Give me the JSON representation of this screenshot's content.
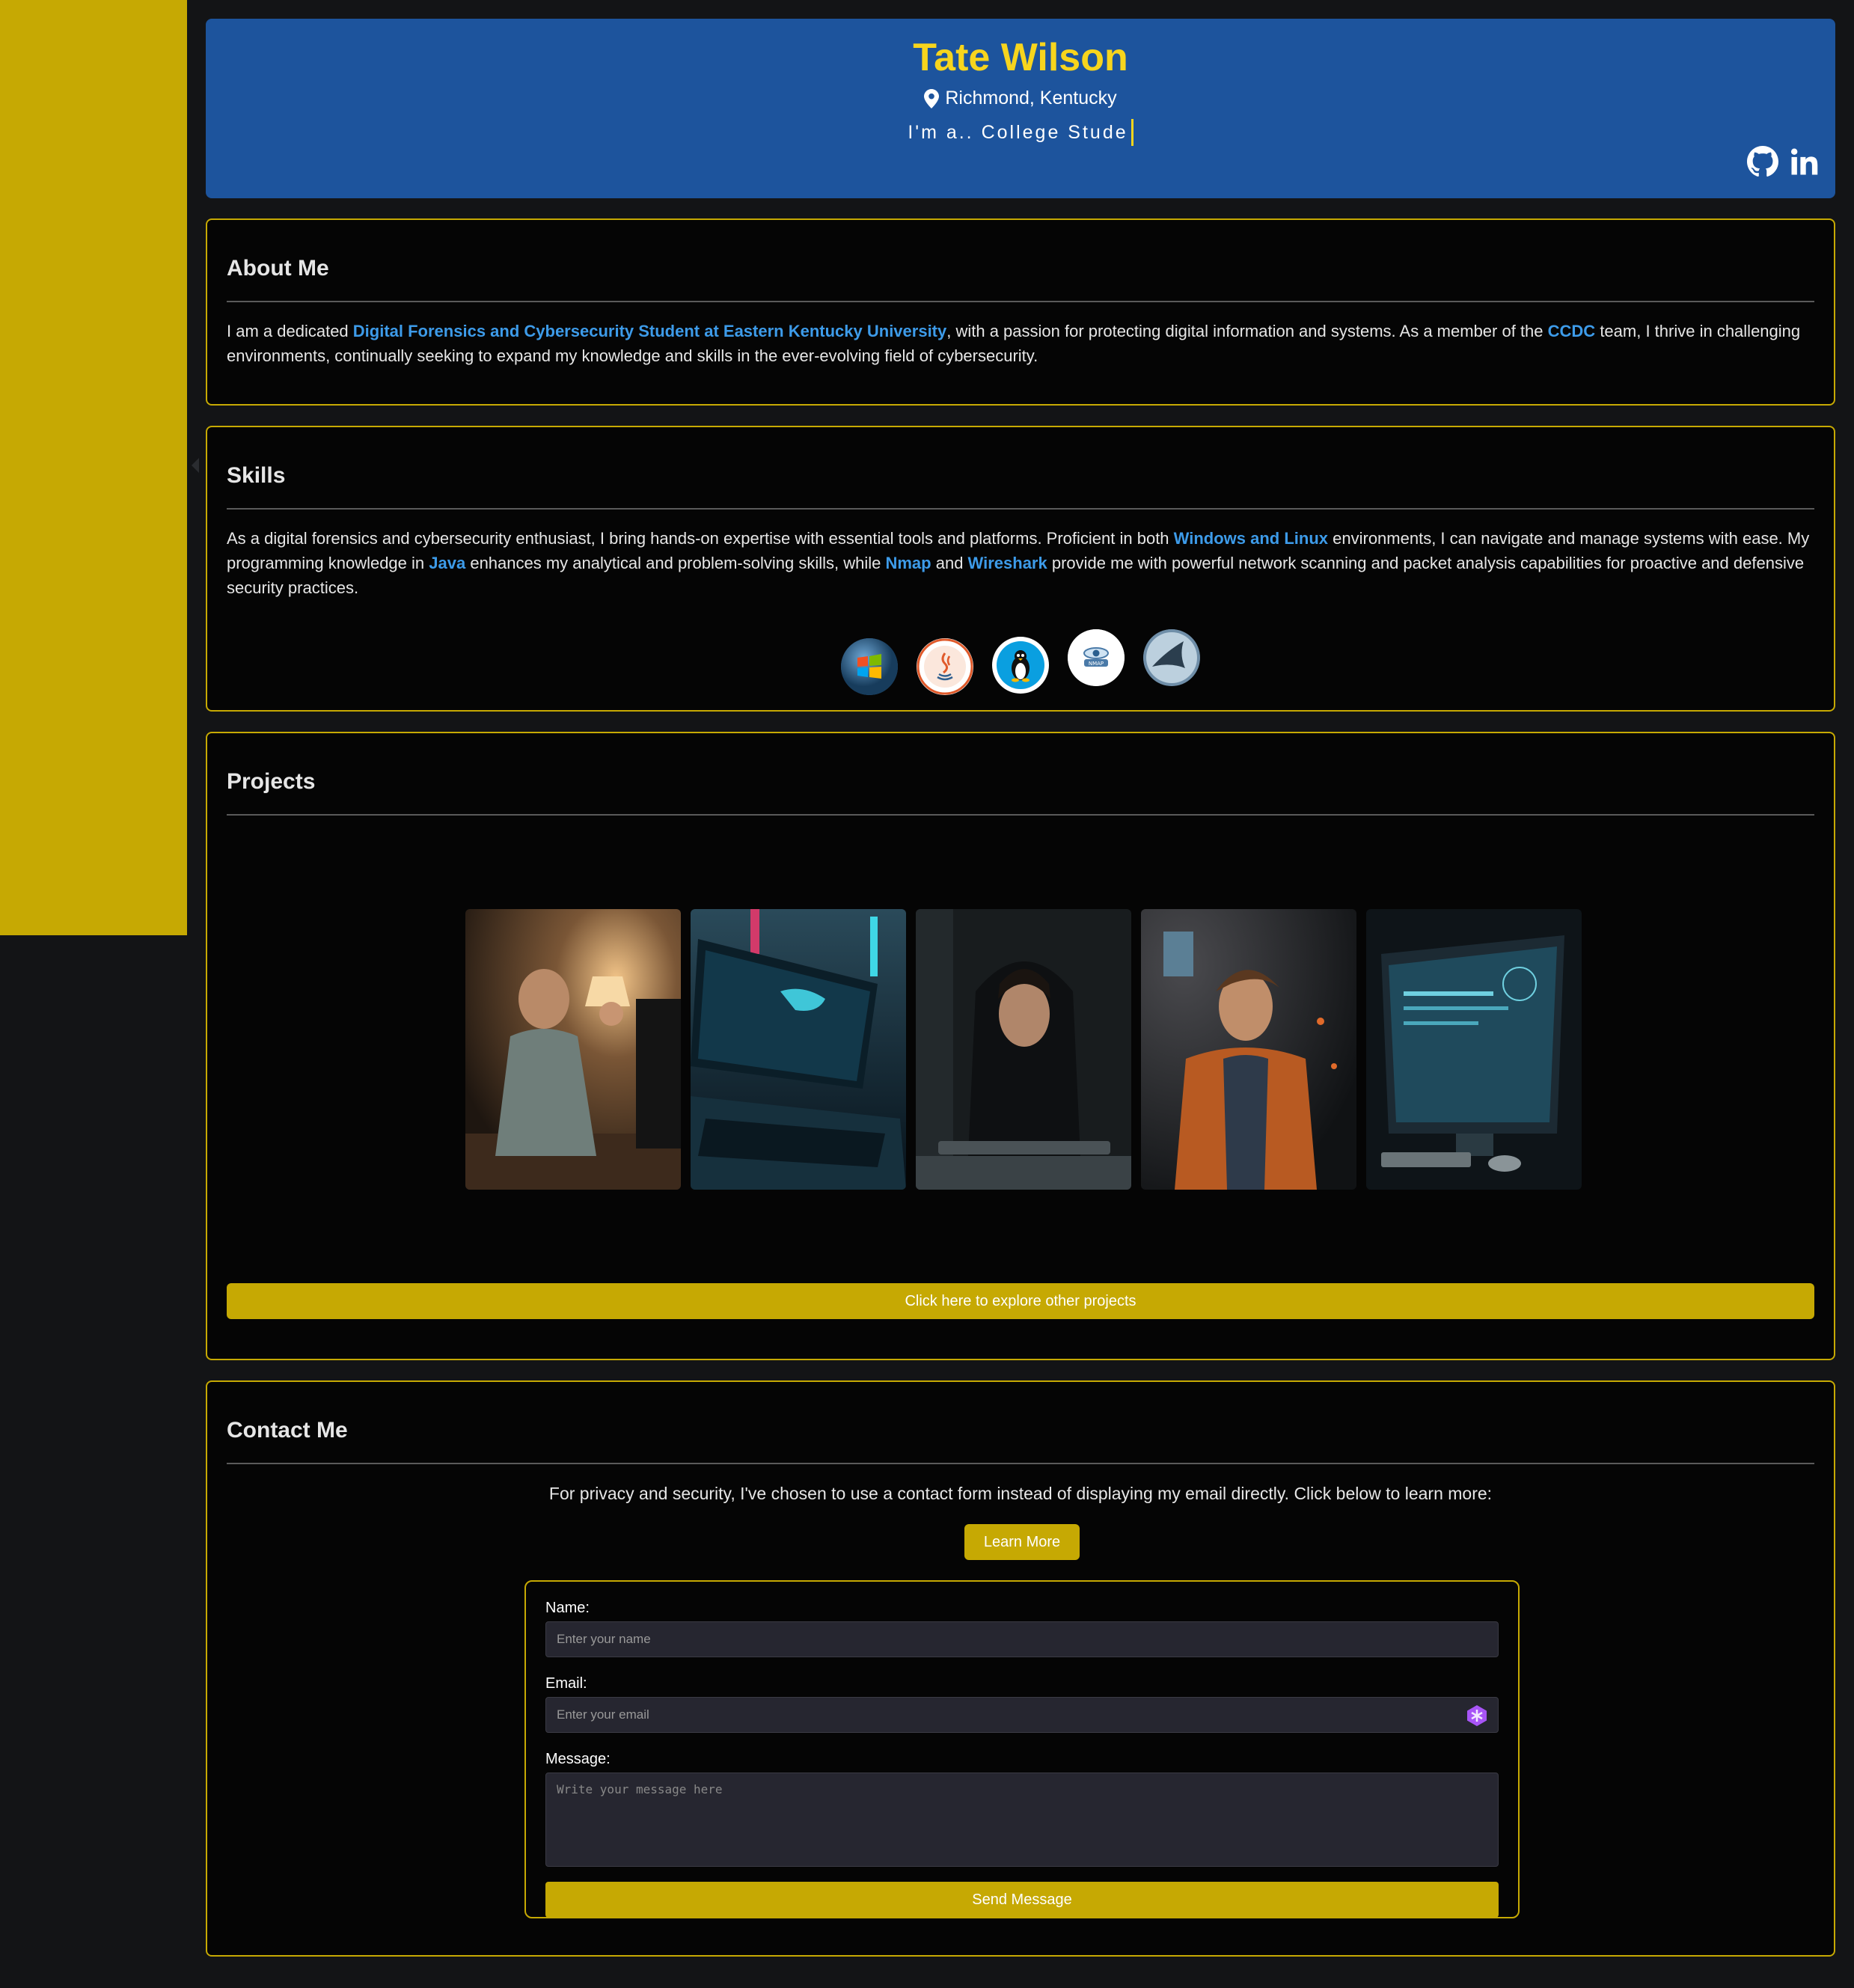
{
  "header": {
    "name": "Tate Wilson",
    "location": "Richmond, Kentucky",
    "typing_prefix": "I'm a.. College Stude"
  },
  "about": {
    "title": "About Me",
    "text_1": "I am a dedicated ",
    "highlight_1": "Digital Forensics and Cybersecurity Student at Eastern Kentucky University",
    "text_2": ", with a passion for protecting digital information and systems. As a member of the ",
    "highlight_2": "CCDC",
    "text_3": " team, I thrive in challenging environments, continually seeking to expand my knowledge and skills in the ever-evolving field of cybersecurity."
  },
  "skills": {
    "title": "Skills",
    "text_1": "As a digital forensics and cybersecurity enthusiast, I bring hands-on expertise with essential tools and platforms. Proficient in both ",
    "highlight_1": "Windows and Linux",
    "text_2": " environments, I can navigate and manage systems with ease. My programming knowledge in ",
    "highlight_2": "Java",
    "text_3": " enhances my analytical and problem-solving skills, while ",
    "highlight_3": "Nmap",
    "text_4": " and ",
    "highlight_4": "Wireshark",
    "text_5": " provide me with powerful network scanning and packet analysis capabilities for proactive and defensive security practices.",
    "icons": [
      "windows-icon",
      "java-icon",
      "linux-icon",
      "nmap-icon",
      "wireshark-icon"
    ],
    "nmap_logo_text": "NMAP"
  },
  "projects": {
    "title": "Projects",
    "explore_label": "Click here to explore other projects"
  },
  "contact": {
    "title": "Contact Me",
    "privacy_text": "For privacy and security, I've chosen to use a contact form instead of displaying my email directly. Click below to learn more:",
    "learn_more_label": "Learn More",
    "name_label": "Name:",
    "name_placeholder": "Enter your name",
    "email_label": "Email:",
    "email_placeholder": "Enter your email",
    "message_label": "Message:",
    "message_placeholder": "Write your message here",
    "send_label": "Send Message"
  },
  "colors": {
    "accent": "#c6a903",
    "header_bg": "#1d549d",
    "name_color": "#f7d51d",
    "link": "#3d9be9"
  }
}
